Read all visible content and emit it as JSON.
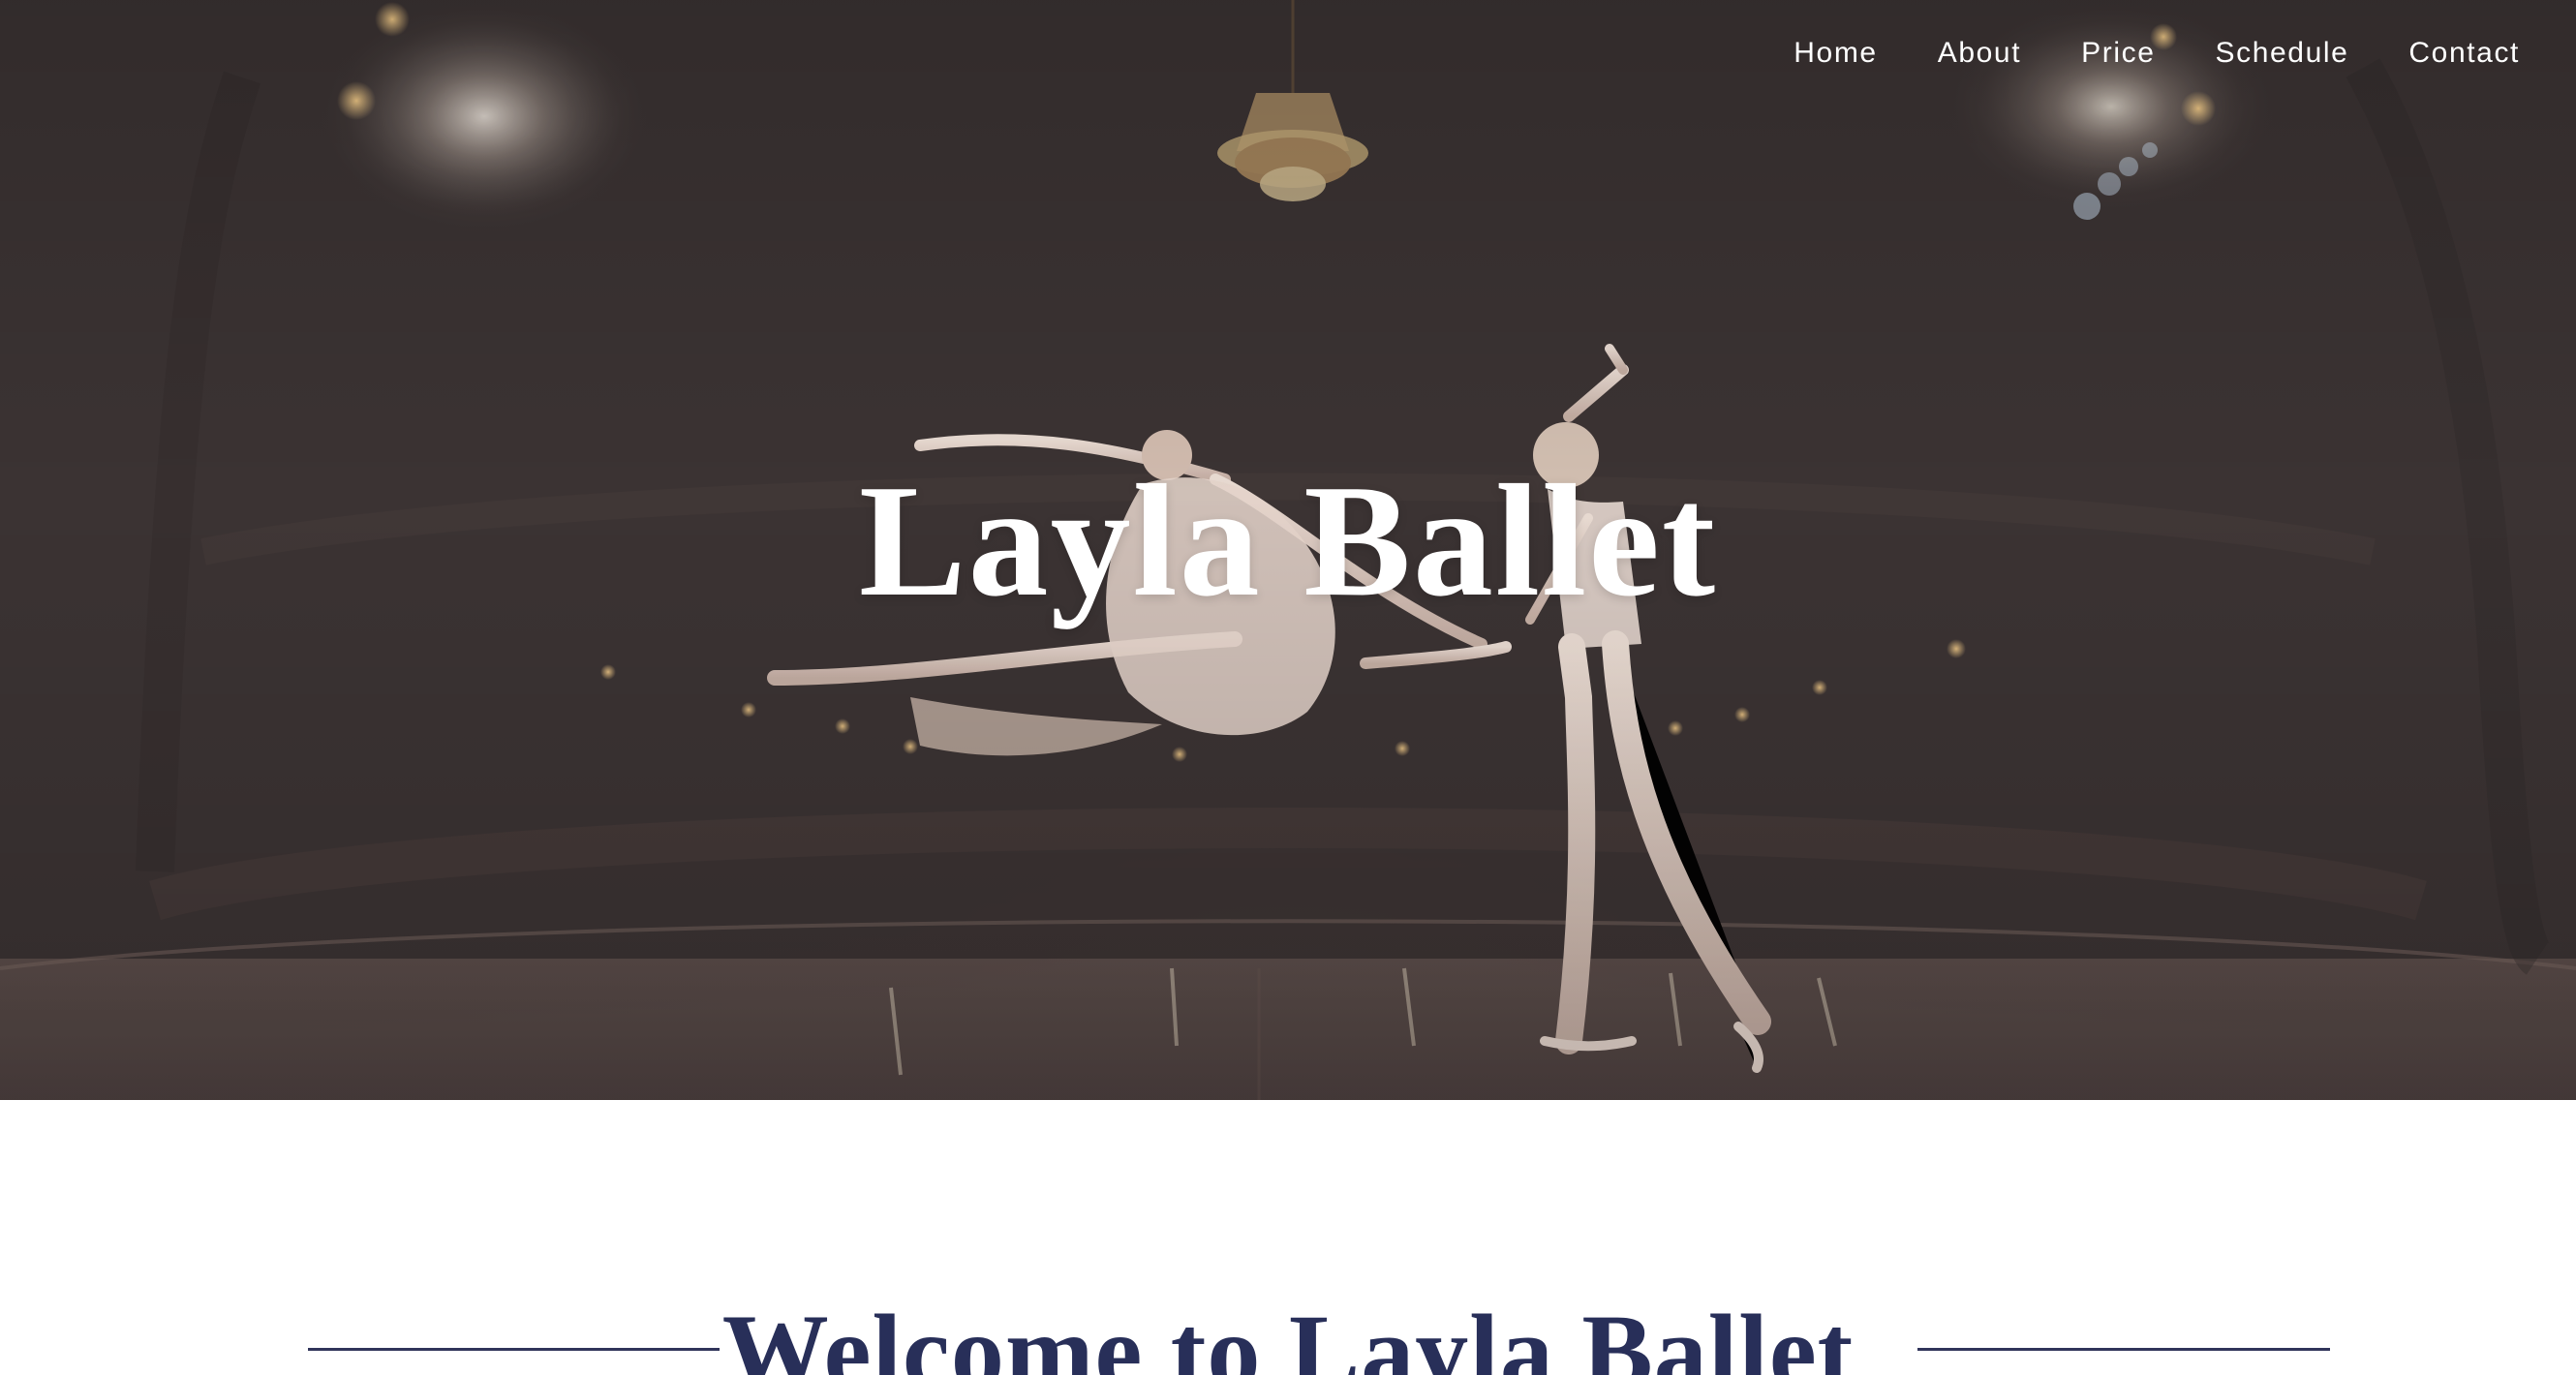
{
  "nav": {
    "items": [
      {
        "label": "Home"
      },
      {
        "label": "About"
      },
      {
        "label": "Price"
      },
      {
        "label": "Schedule"
      },
      {
        "label": "Contact"
      }
    ]
  },
  "hero": {
    "title": "Layla Ballet",
    "image": "ballet-stage-photo"
  },
  "welcome": {
    "heading": "Welcome to Layla Ballet"
  },
  "colors": {
    "hero_overlay": "#3b3333",
    "heading_navy": "#282f59",
    "rule_navy": "#30345a",
    "text_white": "#ffffff"
  }
}
